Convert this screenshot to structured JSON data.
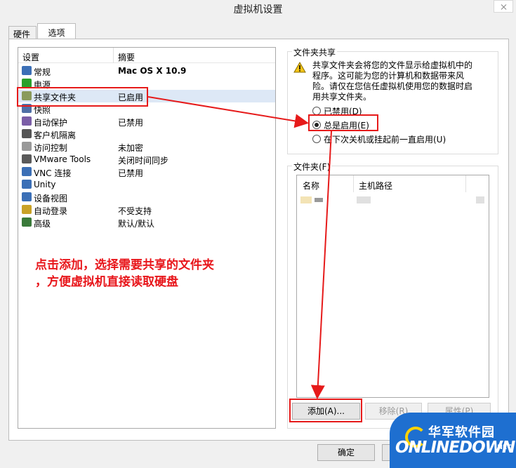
{
  "window": {
    "title": "虚拟机设置"
  },
  "tabs": [
    "硬件",
    "选项"
  ],
  "settings_list": {
    "headers": [
      "设置",
      "摘要"
    ],
    "rows": [
      {
        "name": "常规",
        "summary": "Mac OS X 10.9",
        "icon": "monitor-icon",
        "color": "#3b6fb6"
      },
      {
        "name": "电源",
        "summary": "",
        "icon": "play-icon",
        "color": "#2aa02a"
      },
      {
        "name": "共享文件夹",
        "summary": "已启用",
        "icon": "shared-folder-icon",
        "color": "#8a9a5b"
      },
      {
        "name": "快照",
        "summary": "",
        "icon": "snapshot-icon",
        "color": "#4f6fa6"
      },
      {
        "name": "自动保护",
        "summary": "已禁用",
        "icon": "autoprotect-icon",
        "color": "#7b5ea7"
      },
      {
        "name": "客户机隔离",
        "summary": "",
        "icon": "isolation-icon",
        "color": "#555555"
      },
      {
        "name": "访问控制",
        "summary": "未加密",
        "icon": "lock-icon",
        "color": "#999999"
      },
      {
        "name": "VMware Tools",
        "summary": "关闭时间同步",
        "icon": "vmware-icon",
        "color": "#5a5a5a"
      },
      {
        "name": "VNC 连接",
        "summary": "已禁用",
        "icon": "vnc-icon",
        "color": "#3b6fb6"
      },
      {
        "name": "Unity",
        "summary": "",
        "icon": "unity-icon",
        "color": "#3b6fb6"
      },
      {
        "name": "设备视图",
        "summary": "",
        "icon": "device-view-icon",
        "color": "#3b6fb6"
      },
      {
        "name": "自动登录",
        "summary": "不受支持",
        "icon": "user-icon",
        "color": "#c9a227"
      },
      {
        "name": "高级",
        "summary": "默认/默认",
        "icon": "advanced-icon",
        "color": "#3a7a3a"
      }
    ],
    "selected_index": 2
  },
  "shared_folders": {
    "group_title": "文件夹共享",
    "warning_icon": "warning-icon",
    "description": "共享文件夹会将您的文件显示给虚拟机中的程序。这可能为您的计算机和数据带来风险。请仅在您信任虚拟机使用您的数据时启用共享文件夹。",
    "options": [
      {
        "label": "已禁用(D)",
        "checked": false
      },
      {
        "label": "总是启用(E)",
        "checked": true
      },
      {
        "label": "在下次关机或挂起前一直启用(U)",
        "checked": false
      }
    ]
  },
  "folders": {
    "group_title": "文件夹(F)",
    "headers": [
      "名称",
      "主机路径"
    ],
    "buttons": {
      "add": "添加(A)...",
      "remove": "移除(R)",
      "properties": "属性(P)"
    }
  },
  "annotation": {
    "line1": "点击添加，选择需要共享的文件夹",
    "line2": "，方便虚拟机直接读取硬盘"
  },
  "footer": {
    "ok": "确定"
  },
  "watermark": {
    "cn": "华军软件园",
    "en": "ONLINEDOWN",
    "suffix": ".NET"
  },
  "colors": {
    "annotation_red": "#e61a1a",
    "logo_blue": "#1e6fd0"
  }
}
